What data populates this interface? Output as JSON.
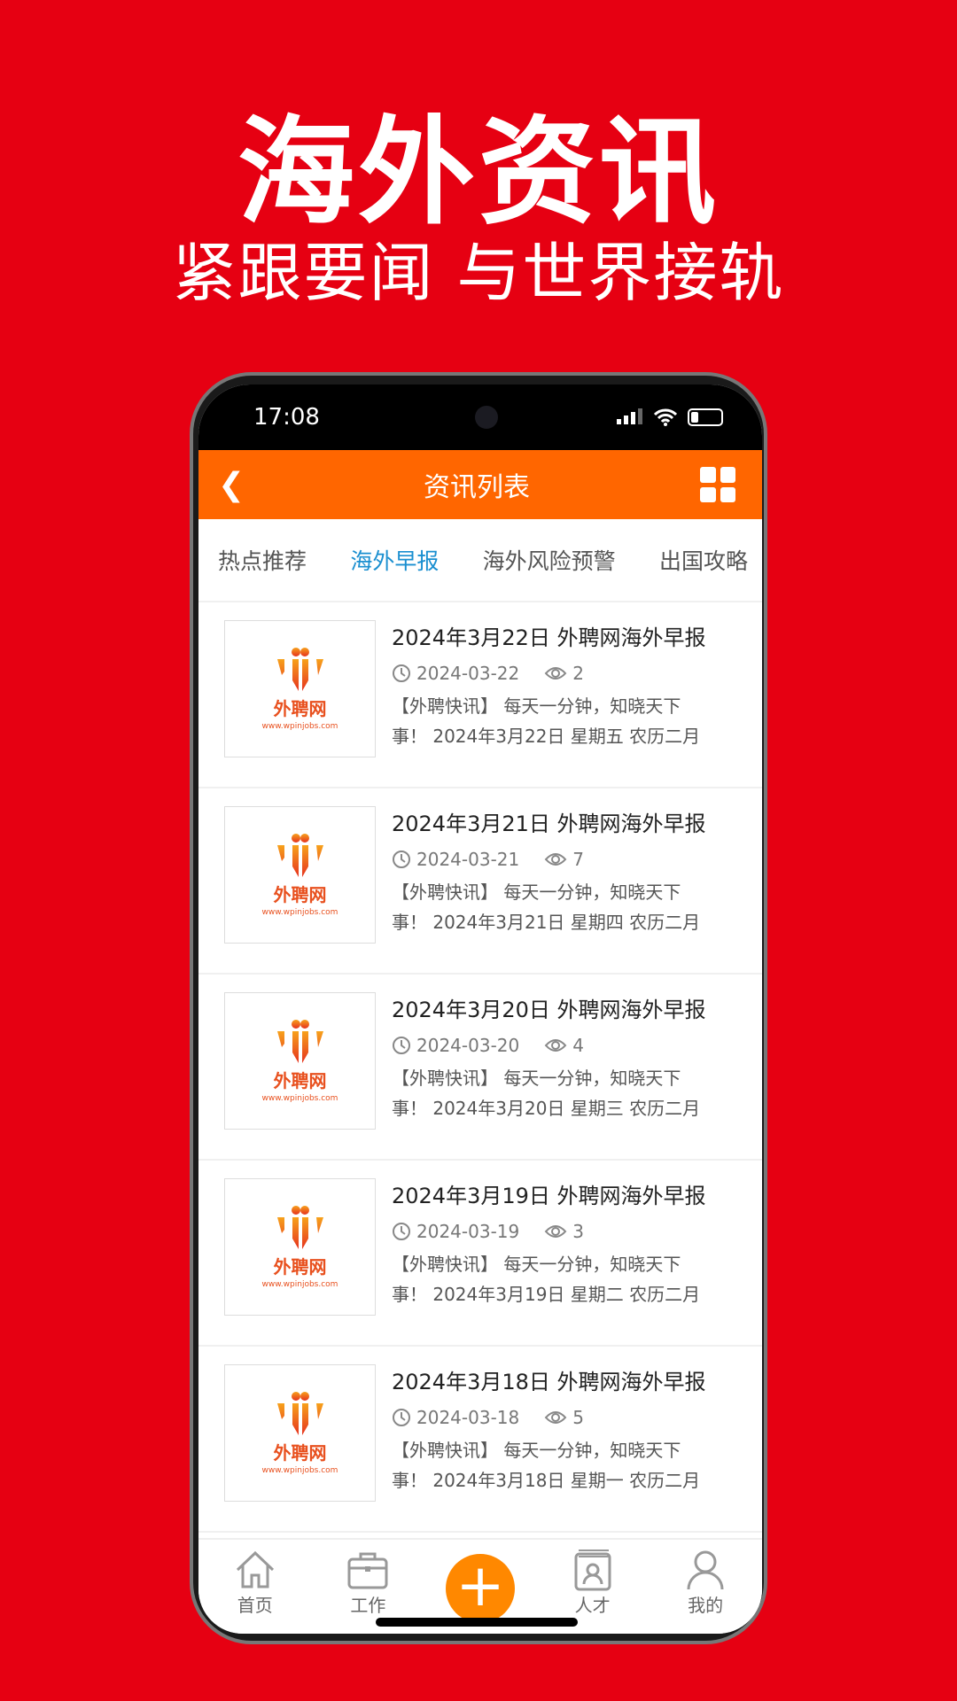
{
  "promo": {
    "headline": "海外资讯",
    "subtitle": "紧跟要闻 与世界接轨"
  },
  "status": {
    "time": "17:08"
  },
  "header": {
    "title": "资讯列表",
    "back_icon": "chevron-left-icon",
    "menu_icon": "grid-icon"
  },
  "tabs": [
    {
      "label": "热点推荐",
      "active": false
    },
    {
      "label": "海外早报",
      "active": true
    },
    {
      "label": "海外风险预警",
      "active": false
    },
    {
      "label": "出国攻略",
      "active": false
    }
  ],
  "colors": {
    "accent": "#ff6600",
    "active_tab": "#1a8fd0",
    "background": "#e60012"
  },
  "thumb": {
    "brand": "外聘网",
    "url": "www.wpinjobs.com"
  },
  "items": [
    {
      "title": "2024年3月22日 外聘网海外早报",
      "date": "2024-03-22",
      "views": "2",
      "desc1": "【外聘快讯】 每天一分钟，知晓天下",
      "desc2": "事！ 2024年3月22日 星期五 农历二月"
    },
    {
      "title": "2024年3月21日 外聘网海外早报",
      "date": "2024-03-21",
      "views": "7",
      "desc1": "【外聘快讯】 每天一分钟，知晓天下",
      "desc2": "事！ 2024年3月21日 星期四 农历二月"
    },
    {
      "title": "2024年3月20日 外聘网海外早报",
      "date": "2024-03-20",
      "views": "4",
      "desc1": "【外聘快讯】 每天一分钟，知晓天下",
      "desc2": "事！ 2024年3月20日 星期三 农历二月"
    },
    {
      "title": "2024年3月19日 外聘网海外早报",
      "date": "2024-03-19",
      "views": "3",
      "desc1": "【外聘快讯】 每天一分钟，知晓天下",
      "desc2": "事！ 2024年3月19日 星期二 农历二月"
    },
    {
      "title": "2024年3月18日 外聘网海外早报",
      "date": "2024-03-18",
      "views": "5",
      "desc1": "【外聘快讯】 每天一分钟，知晓天下",
      "desc2": "事！ 2024年3月18日 星期一 农历二月"
    }
  ],
  "nav": [
    {
      "label": "首页",
      "icon": "home-icon"
    },
    {
      "label": "工作",
      "icon": "briefcase-icon"
    },
    {
      "label": "",
      "icon": "plus-icon"
    },
    {
      "label": "人才",
      "icon": "contact-book-icon"
    },
    {
      "label": "我的",
      "icon": "user-icon"
    }
  ]
}
